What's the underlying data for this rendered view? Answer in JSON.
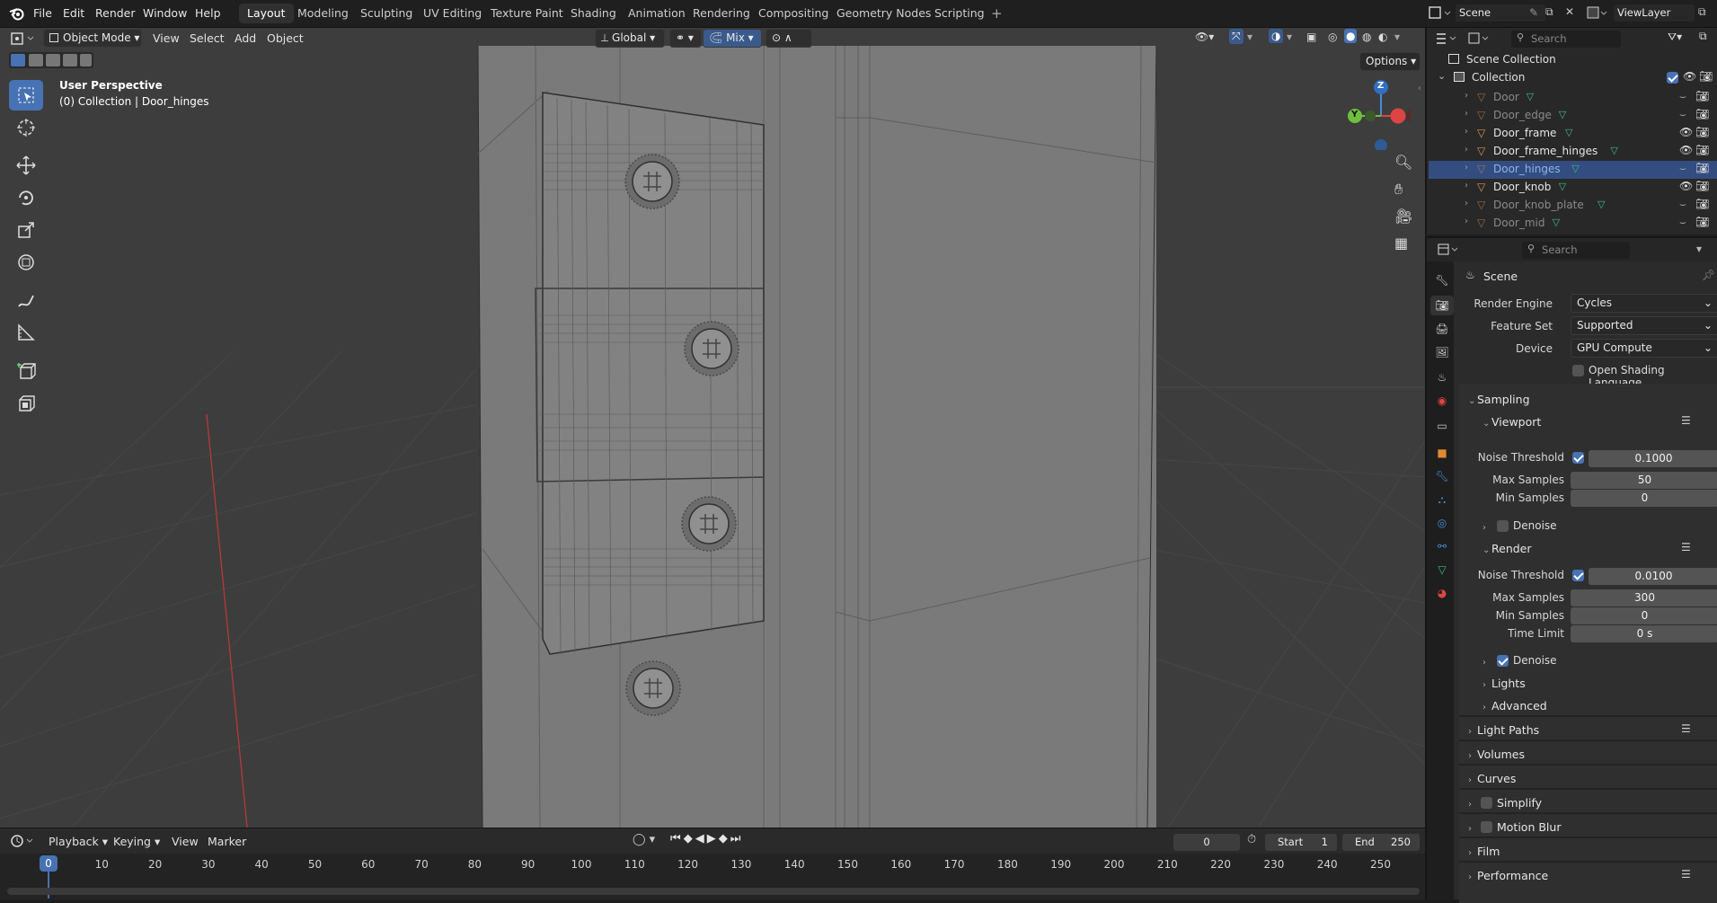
{
  "menu": {
    "file": "File",
    "edit": "Edit",
    "render": "Render",
    "window": "Window",
    "help": "Help"
  },
  "workspaces": [
    "Layout",
    "Modeling",
    "Sculpting",
    "UV Editing",
    "Texture Paint",
    "Shading",
    "Animation",
    "Rendering",
    "Compositing",
    "Geometry Nodes",
    "Scripting"
  ],
  "active_workspace": "Layout",
  "topright": {
    "scene": "Scene",
    "view_layer": "ViewLayer"
  },
  "viewport": {
    "mode": "Object Mode",
    "view": "View",
    "select": "Select",
    "add": "Add",
    "object": "Object",
    "orientation": "Global",
    "snap_mode": "Mix",
    "options": "Options",
    "overlay_title": "User Perspective",
    "overlay_sub": "(0) Collection | Door_hinges",
    "gizmo": {
      "z": "Z",
      "y": "Y"
    }
  },
  "outliner": {
    "search_placeholder": "Search",
    "scene_collection": "Scene Collection",
    "collection": "Collection",
    "items": [
      {
        "name": "Door",
        "dim": true
      },
      {
        "name": "Door_edge",
        "dim": true
      },
      {
        "name": "Door_frame",
        "dim": false
      },
      {
        "name": "Door_frame_hinges",
        "dim": false
      },
      {
        "name": "Door_hinges",
        "dim": true,
        "selected": true
      },
      {
        "name": "Door_knob",
        "dim": false
      },
      {
        "name": "Door_knob_plate",
        "dim": true
      },
      {
        "name": "Door_mid",
        "dim": true
      }
    ]
  },
  "properties": {
    "search_placeholder": "Search",
    "scene": "Scene",
    "render_engine_label": "Render Engine",
    "render_engine": "Cycles",
    "feature_set_label": "Feature Set",
    "feature_set": "Supported",
    "device_label": "Device",
    "device": "GPU Compute",
    "osl": "Open Shading Language",
    "sampling": "Sampling",
    "viewport": "Viewport",
    "noise_threshold_label": "Noise Threshold",
    "vp_noise": "0.1000",
    "max_samples_label": "Max Samples",
    "vp_max": "50",
    "min_samples_label": "Min Samples",
    "vp_min": "0",
    "denoise": "Denoise",
    "render": "Render",
    "r_noise": "0.0100",
    "r_max": "300",
    "r_min": "0",
    "time_limit_label": "Time Limit",
    "time_limit": "0 s",
    "lights": "Lights",
    "advanced": "Advanced",
    "light_paths": "Light Paths",
    "volumes": "Volumes",
    "curves": "Curves",
    "simplify": "Simplify",
    "motion_blur": "Motion Blur",
    "film": "Film",
    "performance": "Performance"
  },
  "timeline": {
    "playback": "Playback",
    "keying": "Keying",
    "view": "View",
    "marker": "Marker",
    "current_frame": "0",
    "start_label": "Start",
    "start": "1",
    "end_label": "End",
    "end": "250",
    "playhead": "0",
    "ticks": [
      "10",
      "20",
      "30",
      "40",
      "50",
      "60",
      "70",
      "80",
      "90",
      "100",
      "110",
      "120",
      "130",
      "140",
      "150",
      "160",
      "170",
      "180",
      "190",
      "200",
      "210",
      "220",
      "230",
      "240",
      "250"
    ]
  },
  "colors": {
    "accent": "#4772b3",
    "selected_row": "#334d80",
    "mesh_icon": "#e09050",
    "data_icon": "#3fbf7f"
  }
}
